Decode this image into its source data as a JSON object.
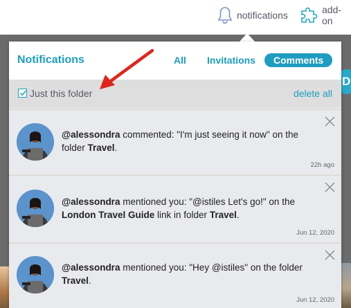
{
  "topbar": {
    "notifications_label": "notifications",
    "addon_label": "add-on"
  },
  "side_badge": "D",
  "popup": {
    "title": "Notifications",
    "tabs": [
      {
        "label": "All",
        "active": false
      },
      {
        "label": "Invitations",
        "active": false
      },
      {
        "label": "Comments",
        "active": true
      }
    ],
    "filter": {
      "checkbox_checked": true,
      "label": "Just this folder",
      "delete_all": "delete all"
    },
    "notifications": [
      {
        "user": "@alessondra",
        "parts": [
          " commented: \"I'm just seeing it now\" on the folder "
        ],
        "folder": "Travel",
        "time": "22h ago"
      },
      {
        "user": "@alessondra",
        "text_a": " mentioned you: \"@istiles Let's go!\" on the ",
        "link": "London Travel Guide",
        "text_b": " link in folder ",
        "folder": "Travel",
        "time": "Jun 12, 2020"
      },
      {
        "user": "@alessondra",
        "text_a": " mentioned you: \"Hey @istiles\" on the folder ",
        "folder": "Travel",
        "time": "Jun 12, 2020"
      }
    ]
  },
  "colors": {
    "accent": "#1b9ec0",
    "annotation_arrow": "#e0251b"
  },
  "icons": {
    "notifications": "bell-icon",
    "addon": "puzzle-icon",
    "close": "close-icon",
    "checkbox": "checkmark-icon"
  }
}
